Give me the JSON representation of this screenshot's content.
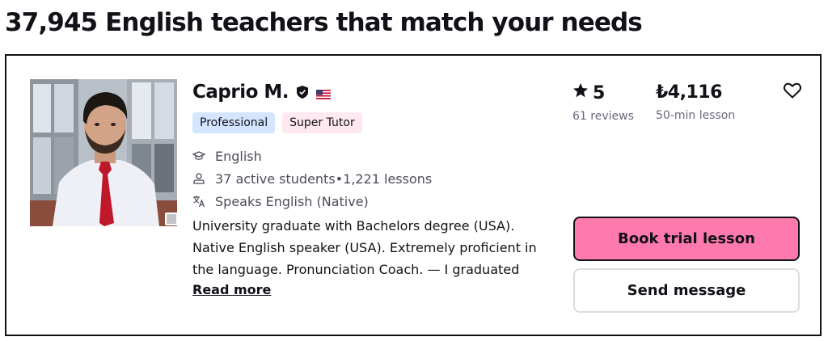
{
  "page": {
    "title": "37,945 English teachers that match your needs"
  },
  "tutor": {
    "name": "Caprio M.",
    "badges": {
      "professional": "Professional",
      "super_tutor": "Super Tutor"
    },
    "subject": "English",
    "students": "37 active students",
    "separator": " • ",
    "lessons": "1,221 lessons",
    "speaks": "Speaks English (Native)",
    "description": "University graduate with Bachelors degree (USA). Native English speaker (USA). Extremely proficient in the language. Pronunciation Coach. — I graduated",
    "read_more": "Read more",
    "rating": "5",
    "reviews": "61 reviews",
    "price": "₺4,116",
    "lesson_length": "50-min lesson",
    "book_label": "Book trial lesson",
    "message_label": "Send message"
  },
  "icons": {
    "verified": "shield-check-icon",
    "flag": "us-flag-icon",
    "subject": "graduation-cap-icon",
    "students": "person-icon",
    "speaks": "translate-icon",
    "rating": "star-icon",
    "favorite": "heart-icon"
  },
  "colors": {
    "book_button": "#ff7aac",
    "badge_professional": "#d4e6ff",
    "badge_super_tutor": "#ffe8ef",
    "text": "#121117",
    "muted": "#6a697c"
  }
}
